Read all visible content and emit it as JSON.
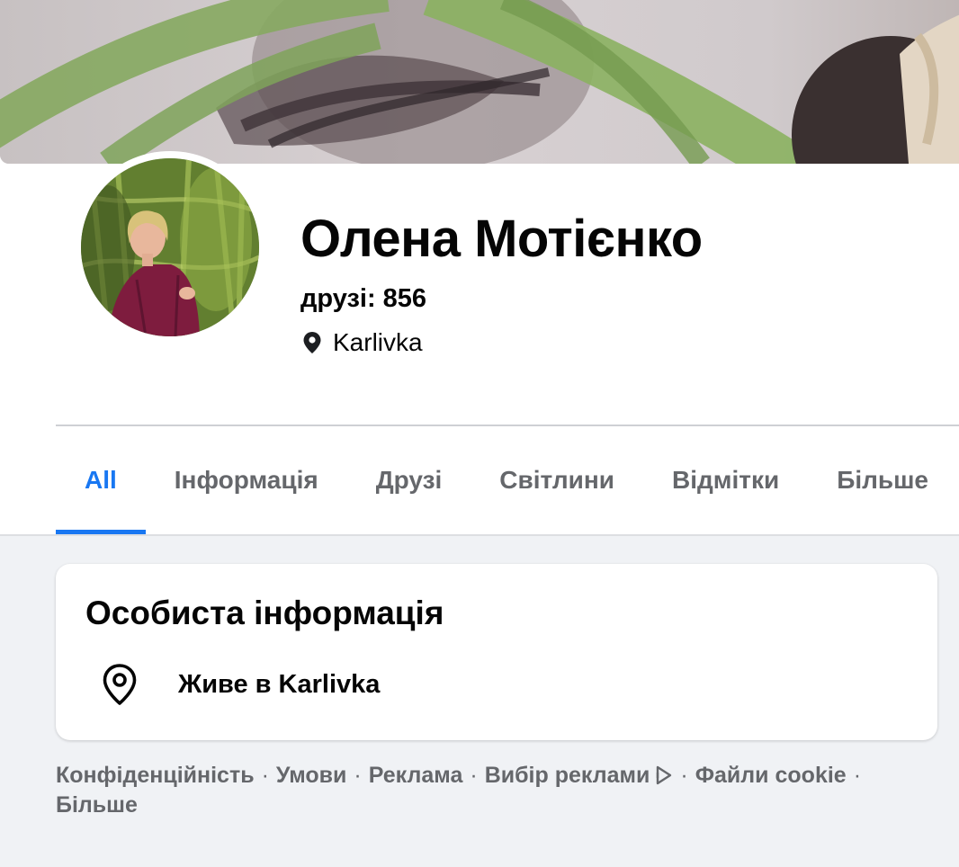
{
  "profile": {
    "name": "Олена Мотієнко",
    "friends": "друзі: 856",
    "location": "Karlivka"
  },
  "tabs": [
    {
      "label": "All",
      "active": true
    },
    {
      "label": "Інформація",
      "active": false
    },
    {
      "label": "Друзі",
      "active": false
    },
    {
      "label": "Світлини",
      "active": false
    },
    {
      "label": "Відмітки",
      "active": false
    },
    {
      "label": "Більше",
      "active": false
    }
  ],
  "card": {
    "title": "Особиста інформація",
    "lives_in": "Живе в Karlivka",
    "icon": "location-pin-icon"
  },
  "footer": {
    "links": [
      "Конфіденційність",
      "Умови",
      "Реклама",
      "Вибір реклами",
      "Файли cookie",
      "Більше"
    ],
    "separator": "·"
  },
  "colors": {
    "accent": "#1877f2",
    "page_background": "#f0f2f5",
    "secondary_text": "#65676b"
  }
}
